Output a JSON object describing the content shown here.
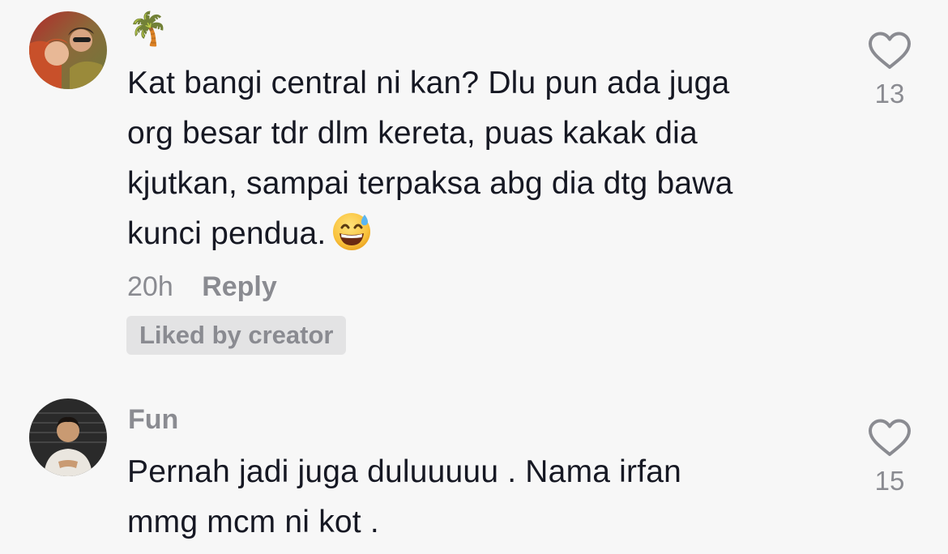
{
  "comments": [
    {
      "username": "🌴",
      "avatar": "avatar-two-people",
      "lines": [
        "Kat bangi central ni kan? Dlu pun ada juga",
        "org besar tdr dlm kereta, puas kakak dia",
        "kjutkan, sampai terpaksa abg dia dtg bawa",
        "kunci pendua."
      ],
      "trailing_emoji": "grinning-face-with-sweat-icon",
      "time": "20h",
      "reply_label": "Reply",
      "liked_badge": "Liked by creator",
      "like_count": "13"
    },
    {
      "username": "Fun",
      "avatar": "avatar-man-dark-background",
      "lines": [
        "Pernah jadi juga duluuuuu . Nama irfan",
        "mmg mcm ni kot ."
      ],
      "like_count": "15"
    }
  ],
  "colors": {
    "background": "#f7f7f7",
    "text_primary": "#161823",
    "text_secondary": "#8a8b91",
    "badge_bg": "#e3e3e4"
  }
}
